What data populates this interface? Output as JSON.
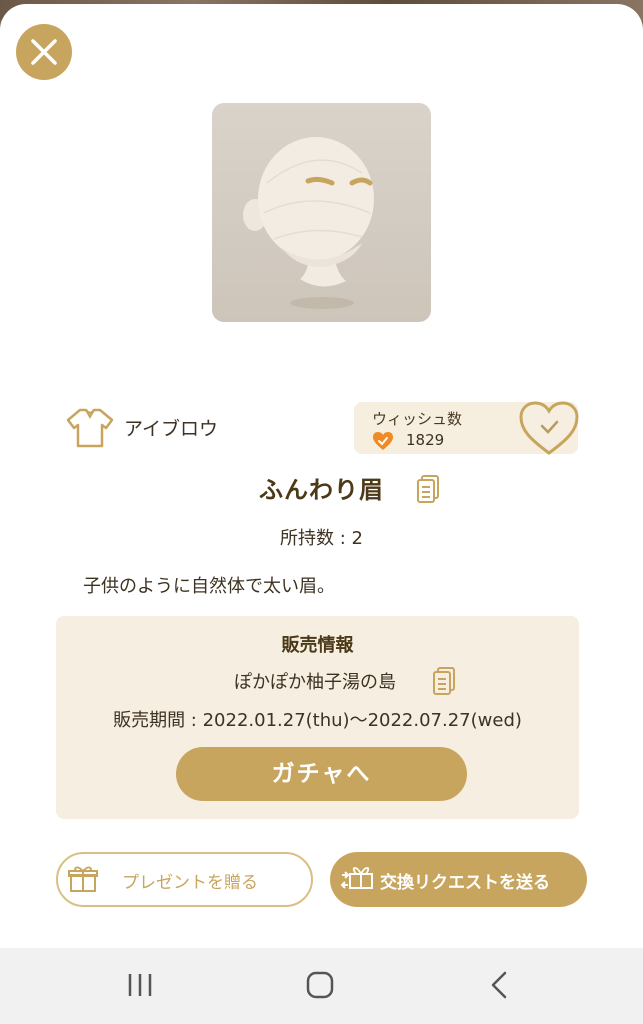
{
  "item": {
    "category": "アイブロウ",
    "name": "ふんわり眉",
    "owned": "所持数 : 2",
    "description": "子供のように自然体で太い眉。"
  },
  "wish": {
    "label": "ウィッシュ数",
    "count": "1829"
  },
  "sale": {
    "title": "販売情報",
    "location": "ぽかぽか柚子湯の島",
    "period": "販売期間 : 2022.01.27(thu)〜2022.07.27(wed)",
    "gacha_label": "ガチャへ"
  },
  "actions": {
    "present_label": "プレゼントを贈る",
    "trade_label": "交換リクエストを送る"
  },
  "icons": {
    "close": "close-icon",
    "category": "shirt-icon",
    "wish_small": "heart-icon",
    "wish_big": "heart-check-icon",
    "copy": "copy-icon",
    "present": "gift-icon",
    "trade": "exchange-icon"
  },
  "colors": {
    "accent": "#c8a55e",
    "panel": "#f6efe1",
    "text": "#3e3222",
    "heart": "#f08a24"
  }
}
